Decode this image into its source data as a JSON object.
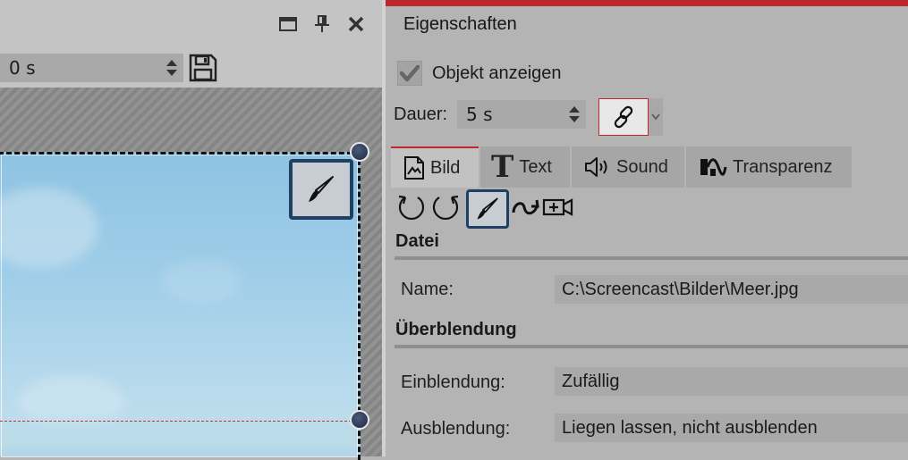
{
  "left_panel": {
    "window_buttons": [
      "maximize-icon",
      "pin-icon",
      "close-icon"
    ],
    "time_field": {
      "value": "0 s"
    },
    "save_icon": "floppy-disk-icon",
    "edit_overlay_icon": "brush-icon"
  },
  "properties": {
    "title": "Eigenschaften",
    "show_object": {
      "label": "Objekt anzeigen",
      "checked": true
    },
    "duration": {
      "label": "Dauer:",
      "value": "5 s"
    },
    "link_icon": "chain-link-icon",
    "tabs": [
      {
        "label": "Bild",
        "icon": "image-icon",
        "active": true
      },
      {
        "label": "Text",
        "icon": "text-T-icon",
        "active": false
      },
      {
        "label": "Sound",
        "icon": "speaker-icon",
        "active": false
      },
      {
        "label": "Transparenz",
        "icon": "transparency-icon",
        "active": false
      }
    ],
    "tools": [
      "rotate-left-icon",
      "rotate-right-icon",
      "brush-icon",
      "curve-arrow-icon",
      "camera-add-icon"
    ],
    "sections": {
      "file": {
        "heading": "Datei",
        "name_label": "Name:",
        "name_value": "C:\\Screencast\\Bilder\\Meer.jpg"
      },
      "transition": {
        "heading": "Überblendung",
        "fade_in_label": "Einblendung:",
        "fade_in_value": "Zufällig",
        "fade_out_label": "Ausblendung:",
        "fade_out_value": "Liegen lassen, nicht ausblenden"
      }
    }
  },
  "colors": {
    "accent": "#c0272d",
    "selected_tool_border": "#1f3f63"
  }
}
